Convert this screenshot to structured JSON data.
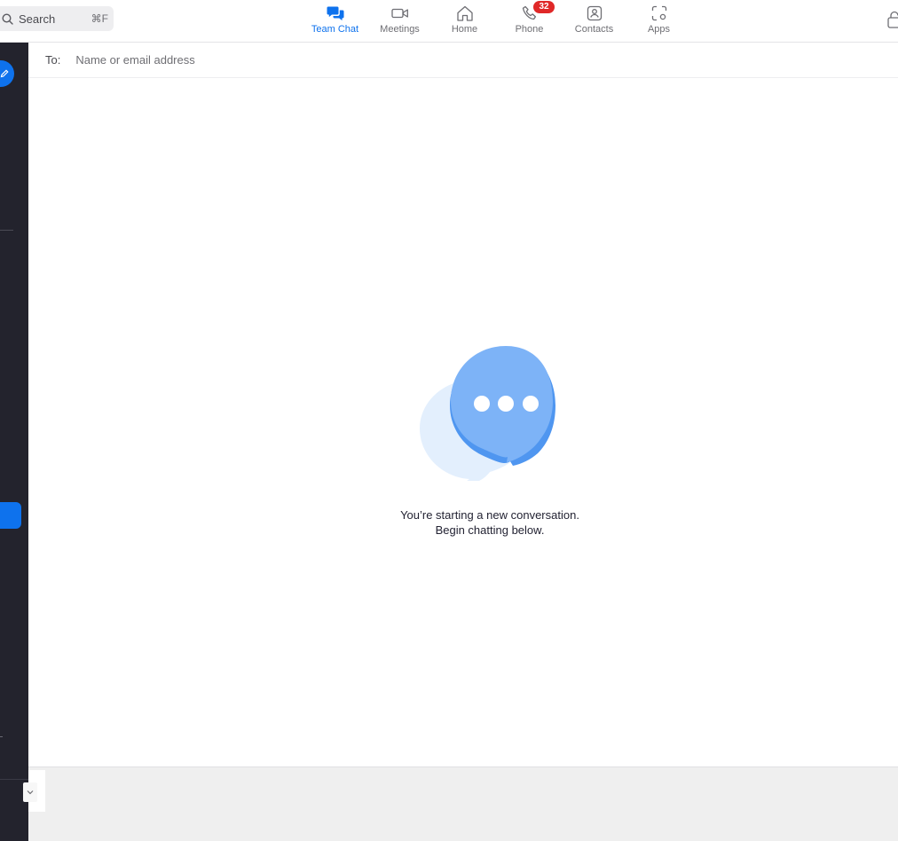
{
  "search": {
    "label": "Search",
    "shortcut": "⌘F"
  },
  "nav": {
    "active": "Team Chat",
    "items": [
      {
        "label": "Team Chat",
        "icon": "chat-bubbles-icon"
      },
      {
        "label": "Meetings",
        "icon": "video-camera-icon"
      },
      {
        "label": "Home",
        "icon": "home-icon"
      },
      {
        "label": "Phone",
        "icon": "phone-icon",
        "badge": "32"
      },
      {
        "label": "Contacts",
        "icon": "contacts-icon"
      },
      {
        "label": "Apps",
        "icon": "apps-icon"
      }
    ]
  },
  "recipient": {
    "label": "To:",
    "placeholder": "Name or email address"
  },
  "empty_state": {
    "line1": "You’re starting a new conversation.",
    "line2": "Begin chatting below.",
    "icon": "chat-bubbles-illustration"
  },
  "colors": {
    "accent": "#0e72ed",
    "sidebar": "#23232d",
    "badge": "#e02828",
    "bubble_front": "#7db3f7",
    "bubble_back": "#e3effd",
    "composer_bg": "#efefef"
  }
}
